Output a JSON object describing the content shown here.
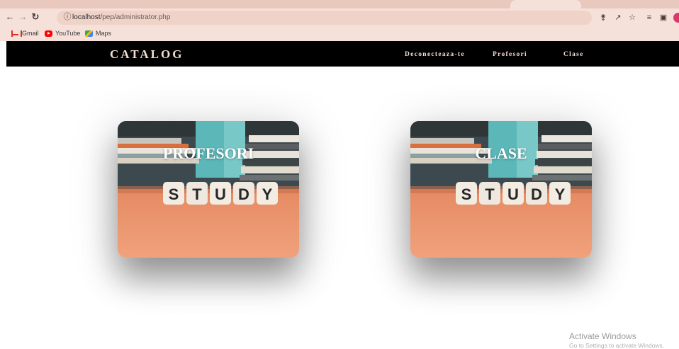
{
  "browser": {
    "url_host": "localhost",
    "url_path": "/pep/administrator.php",
    "icons": {
      "back": "arrow-left-icon",
      "forward": "arrow-right-icon",
      "reload": "reload-icon",
      "site_info": "info-icon",
      "key": "key-icon",
      "share": "share-icon",
      "bookmark_star": "star-icon",
      "reading_list": "reading-list-icon",
      "side_panel": "side-panel-icon"
    },
    "bookmarks": [
      {
        "label": "Gmail",
        "icon": "gmail-icon"
      },
      {
        "label": "YouTube",
        "icon": "youtube-icon"
      },
      {
        "label": "Maps",
        "icon": "maps-icon"
      }
    ],
    "colors": {
      "frame": "#f6e1da",
      "tabstrip": "#e9c8bd",
      "omnibox": "#efd3c9"
    }
  },
  "site": {
    "logo": "CATALOG",
    "nav": {
      "logout": "Deconecteaza-te",
      "teachers": "Profesori",
      "classes": "Clase"
    },
    "colors": {
      "header_bg": "#000000",
      "header_text": "#f5ddd2"
    }
  },
  "cards": [
    {
      "title": "PROFESORI",
      "image_text": "STUDY"
    },
    {
      "title": "CLASE",
      "image_text": "STUDY"
    }
  ],
  "os": {
    "activation_title": "Activate Windows",
    "activation_sub": "Go to Settings to activate Windows."
  }
}
